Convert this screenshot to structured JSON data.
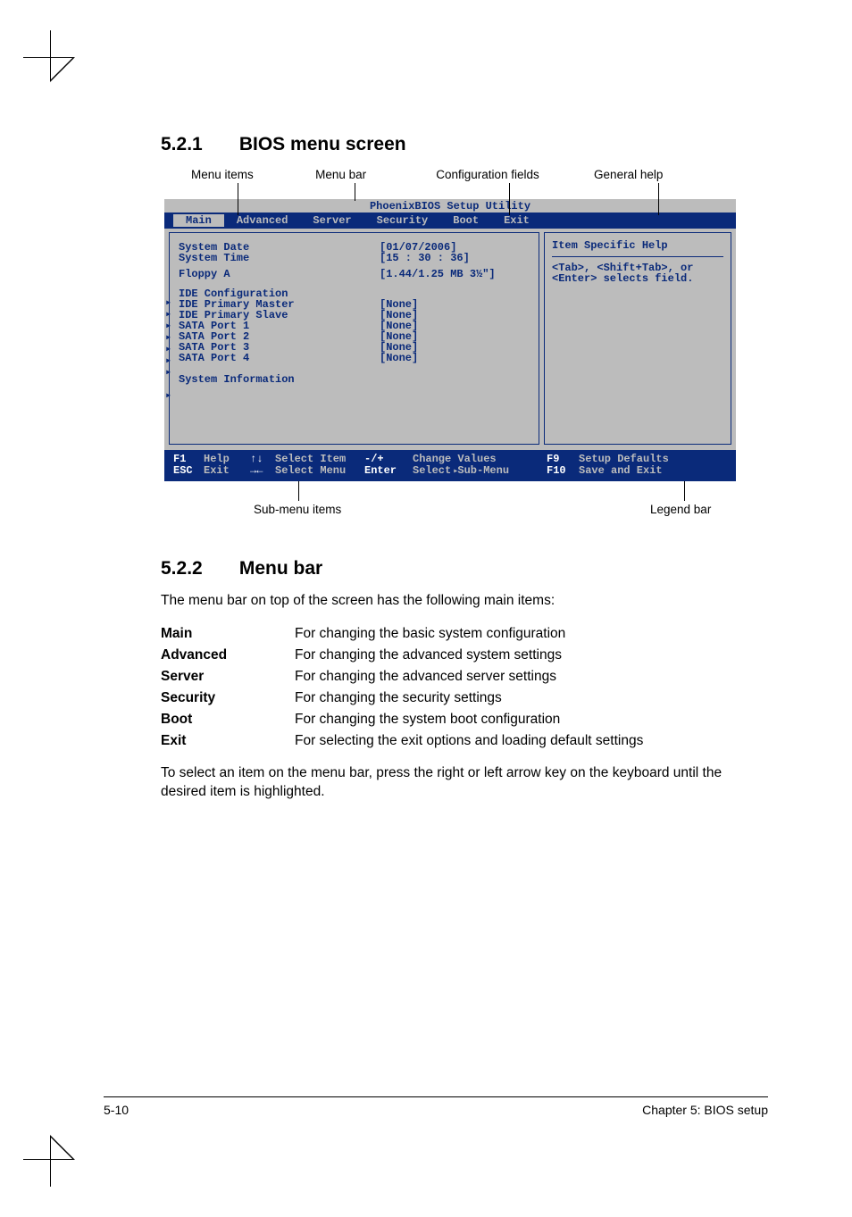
{
  "section1": {
    "num": "5.2.1",
    "title": "BIOS menu screen"
  },
  "fig_labels": {
    "menu_items": "Menu items",
    "menu_bar": "Menu bar",
    "config_fields": "Configuration fields",
    "general_help": "General help",
    "submenu_items": "Sub-menu items",
    "legend_bar": "Legend bar"
  },
  "bios": {
    "title": "PhoenixBIOS Setup Utility",
    "menubar": [
      "Main",
      "Advanced",
      "Server",
      "Security",
      "Boot",
      "Exit"
    ],
    "left_rows": [
      {
        "lab": "System Date",
        "val": "[01/07/2006]"
      },
      {
        "lab": "System Time",
        "val": "[15 : 30 : 36]"
      },
      {
        "lab": "Floppy A",
        "val": "[1.44/1.25 MB 3½\"]"
      }
    ],
    "left_sub": [
      {
        "lab": "IDE Configuration",
        "val": ""
      },
      {
        "lab": "IDE Primary Master",
        "val": "[None]"
      },
      {
        "lab": "IDE Primary Slave",
        "val": "[None]"
      },
      {
        "lab": "SATA Port 1",
        "val": "[None]"
      },
      {
        "lab": "SATA Port 2",
        "val": "[None]"
      },
      {
        "lab": "SATA Port 3",
        "val": "[None]"
      },
      {
        "lab": "SATA Port 4",
        "val": "[None]"
      }
    ],
    "left_last": {
      "lab": "System Information",
      "val": ""
    },
    "help_title": "Item Specific Help",
    "help_text": "<Tab>, <Shift+Tab>, or <Enter> selects field.",
    "legend": {
      "f1": "F1",
      "help": "Help",
      "updn": "↑↓",
      "select_item": "Select Item",
      "esc": "ESC",
      "exit": "Exit",
      "lr": "→←",
      "select_menu": "Select Menu",
      "pm": "-/+",
      "change_values": "Change Values",
      "enter": "Enter",
      "select_sub": "Select   Sub-Menu",
      "f9": "F9",
      "setup_defaults": "Setup Defaults",
      "f10": "F10",
      "save_exit": "Save and Exit"
    }
  },
  "section2": {
    "num": "5.2.2",
    "title": "Menu bar"
  },
  "intro2": "The menu bar on top of the screen has the following main items:",
  "defs": [
    {
      "term": "Main",
      "desc": "For changing the basic system configuration"
    },
    {
      "term": "Advanced",
      "desc": "For changing the advanced system settings"
    },
    {
      "term": "Server",
      "desc": "For changing the advanced server settings"
    },
    {
      "term": "Security",
      "desc": "For changing the security settings"
    },
    {
      "term": "Boot",
      "desc": "For changing the system boot configuration"
    },
    {
      "term": "Exit",
      "desc": "For selecting the exit options and loading default settings"
    }
  ],
  "outro": "To select an item on the menu bar, press the right or left arrow key on the keyboard until the desired item is highlighted.",
  "footer": {
    "left": "5-10",
    "right": "Chapter 5: BIOS setup"
  }
}
